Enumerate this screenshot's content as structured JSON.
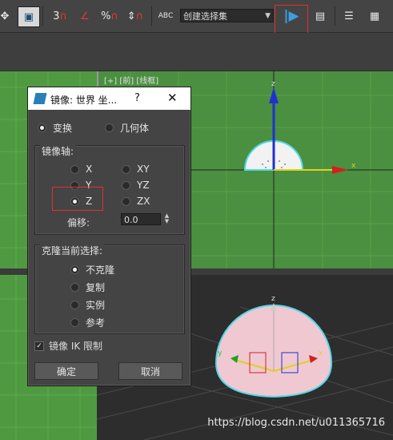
{
  "toolbar": {
    "snap_labels": [
      "3",
      "%"
    ],
    "named_selection": "创建选择集",
    "abc_label": "ABC"
  },
  "viewport": {
    "front_label": "[+] [前] [线框]",
    "axis_x": "x",
    "axis_y": "y",
    "axis_z": "z"
  },
  "dialog": {
    "title": "镜像: 世界 坐...",
    "help": "?",
    "close": "✕",
    "mode": {
      "transform": "变换",
      "geometry": "几何体",
      "selected": "transform"
    },
    "mirror_axis": {
      "title": "镜像轴:",
      "options": [
        "X",
        "Y",
        "Z",
        "XY",
        "YZ",
        "ZX"
      ],
      "selected": "Z"
    },
    "offset": {
      "label": "偏移:",
      "value": "0.0"
    },
    "clone": {
      "title": "克隆当前选择:",
      "options": [
        "不克隆",
        "复制",
        "实例",
        "参考"
      ],
      "selected": "不克隆"
    },
    "ik_limit": {
      "label": "镜像 IK 限制",
      "checked": true
    },
    "ok": "确定",
    "cancel": "取消"
  },
  "watermark": "https://blog.csdn.net/u011365716",
  "colors": {
    "accent_red": "#e03030",
    "viewport_green": "#4f9a41",
    "dialog_bg": "#444444"
  }
}
